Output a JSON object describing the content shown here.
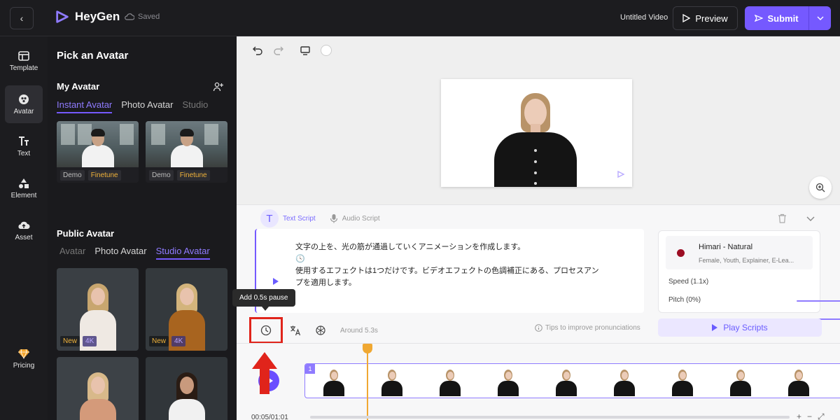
{
  "header": {
    "back_icon": "chevron-left-icon",
    "brand": "HeyGen",
    "saved_status": "Saved",
    "video_title": "Untitled Video",
    "preview_label": "Preview",
    "submit_label": "Submit",
    "accent_color": "#7559ff"
  },
  "nav": {
    "items": [
      {
        "label": "Template",
        "icon": "template-icon"
      },
      {
        "label": "Avatar",
        "icon": "avatar-icon",
        "active": true
      },
      {
        "label": "Text",
        "icon": "text-icon"
      },
      {
        "label": "Element",
        "icon": "shapes-icon"
      },
      {
        "label": "Asset",
        "icon": "upload-cloud-icon"
      }
    ],
    "pricing_label": "Pricing"
  },
  "avatar_panel": {
    "title": "Pick an Avatar",
    "my_avatar": {
      "title": "My Avatar",
      "tabs": [
        "Instant Avatar",
        "Photo Avatar",
        "Studio"
      ],
      "cards": [
        {
          "tags": [
            "Demo",
            "Finetune"
          ]
        },
        {
          "tags": [
            "Demo",
            "Finetune"
          ]
        }
      ]
    },
    "public_avatar": {
      "title": "Public Avatar",
      "tabs": [
        "Avatar",
        "Photo Avatar",
        "Studio Avatar"
      ],
      "cards": [
        {
          "tags": [
            "New",
            "4K"
          ]
        },
        {
          "tags": [
            "New",
            "4K"
          ]
        }
      ]
    }
  },
  "script": {
    "tabs": [
      "Text Script",
      "Audio Script"
    ],
    "lines": [
      "文字の上を、光の筋が通過していくアニメーションを作成します。",
      "🕓",
      "使用するエフェクトは1つだけです。ビデオエフェクトの色調補正にある、プロセスアン",
      "プを適用します。"
    ],
    "tooltip": "Add 0.5s pause",
    "duration": "Around 5.3s",
    "tips": "Tips to improve pronunciations",
    "play_label": "Play Scripts"
  },
  "voice": {
    "name": "Himari - Natural",
    "description": "Female, Youth, Explainer, E-Lea...",
    "speed_label": "Speed (1.1x)",
    "speed_value": 0.55,
    "pitch_label": "Pitch (0%)",
    "pitch_value": 0.5
  },
  "timeline": {
    "track_number": "1",
    "time": "00:05/01:01"
  }
}
